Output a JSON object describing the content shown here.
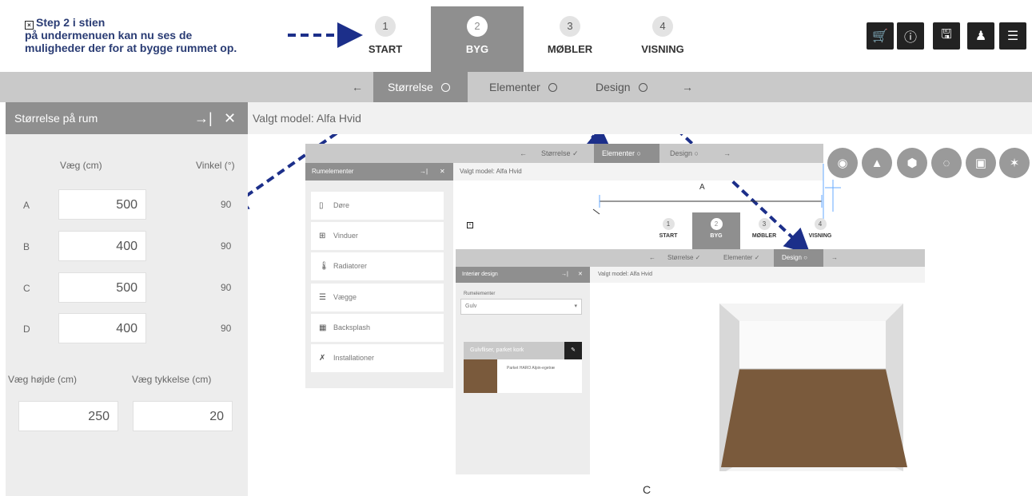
{
  "annotation": {
    "line1": "Step 2 i stien",
    "line2": "på undermenuen kan nu ses de",
    "line3": "muligheder der for at bygge rummet op."
  },
  "steps": [
    {
      "num": "1",
      "label": "START"
    },
    {
      "num": "2",
      "label": "BYG"
    },
    {
      "num": "3",
      "label": "MØBLER"
    },
    {
      "num": "4",
      "label": "VISNING"
    }
  ],
  "toolbar": {
    "cart_icon": "cart-icon",
    "info_icon": "info-icon",
    "save_icon": "save-icon",
    "user_icon": "user-settings-icon",
    "menu_icon": "hamburger-menu-icon"
  },
  "submenu": {
    "back": "←",
    "items": [
      "Størrelse",
      "Elementer",
      "Design"
    ],
    "forward": "→"
  },
  "panel": {
    "title": "Størrelse på rum",
    "col_wall": "Væg (cm)",
    "col_angle": "Vinkel (°)",
    "rows": [
      {
        "label": "A",
        "value": "500",
        "angle": "90"
      },
      {
        "label": "B",
        "value": "400",
        "angle": "90"
      },
      {
        "label": "C",
        "value": "500",
        "angle": "90"
      },
      {
        "label": "D",
        "value": "400",
        "angle": "90"
      }
    ],
    "height_label": "Væg højde (cm)",
    "thickness_label": "Væg tykkelse (cm)",
    "height_value": "250",
    "thickness_value": "20"
  },
  "model": {
    "label": "Valgt model: Alfa Hvid"
  },
  "embedded1": {
    "sub_items": [
      "Størrelse",
      "Elementer",
      "Design"
    ],
    "panel_title": "Rumelementer",
    "model": "Valgt model: Alfa Hvid",
    "items": [
      "Døre",
      "Vinduer",
      "Radiatorer",
      "Vægge",
      "Backsplash",
      "Installationer"
    ],
    "dim_label": "A"
  },
  "embedded2": {
    "steps": [
      {
        "num": "1",
        "label": "START"
      },
      {
        "num": "2",
        "label": "BYG"
      },
      {
        "num": "3",
        "label": "MØBLER"
      },
      {
        "num": "4",
        "label": "VISNING"
      }
    ],
    "sub_items": [
      "Størrelse",
      "Elementer",
      "Design"
    ],
    "panel_title": "Interiør design",
    "model": "Valgt model: Alfa Hvid",
    "dropdown_label": "Rumelementer",
    "dropdown_value": "Gulv",
    "card_title": "Gulvfliser, parket kork",
    "card_item": "Parket HARO Alpin-egetræ"
  },
  "bottom_label": "C",
  "colors": {
    "active_gray": "#8f8f8f",
    "bar_gray": "#c9c9c9",
    "annotation_blue": "#2a3c74",
    "floor_brown": "#7a5a3c"
  }
}
